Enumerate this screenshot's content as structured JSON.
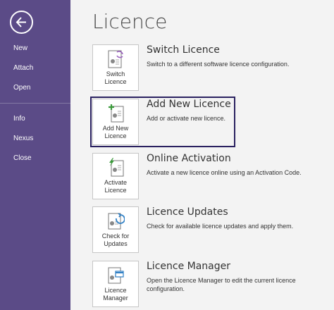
{
  "sidebar": {
    "back_icon": "back-arrow-icon",
    "items": [
      {
        "label": "New"
      },
      {
        "label": "Attach"
      },
      {
        "label": "Open"
      },
      {
        "label": "Info"
      },
      {
        "label": "Nexus"
      },
      {
        "label": "Close"
      }
    ]
  },
  "page": {
    "title": "Licence"
  },
  "options": [
    {
      "tile_label": "Switch\nLicence",
      "title": "Switch Licence",
      "description": "Switch to a different software licence configuration.",
      "icon": "switch-licence-icon"
    },
    {
      "tile_label": "Add New\nLicence",
      "title": "Add New Licence",
      "description": "Add or activate new licence.",
      "icon": "add-licence-icon",
      "selected": true
    },
    {
      "tile_label": "Activate\nLicence",
      "title": "Online Activation",
      "description": "Activate a new licence online using an Activation Code.",
      "icon": "activate-licence-icon"
    },
    {
      "tile_label": "Check for\nUpdates",
      "title": "Licence Updates",
      "description": "Check for available licence updates and apply them.",
      "icon": "licence-updates-icon"
    },
    {
      "tile_label": "Licence\nManager",
      "title": "Licence Manager",
      "description": "Open the Licence Manager to edit the current licence configuration.",
      "icon": "licence-manager-icon"
    }
  ],
  "colors": {
    "sidebar": "#5b4b87",
    "highlight": "#2a2160",
    "accent_green": "#3a9a3a",
    "accent_purple": "#9a5fc0",
    "accent_blue": "#2f7fc4"
  }
}
